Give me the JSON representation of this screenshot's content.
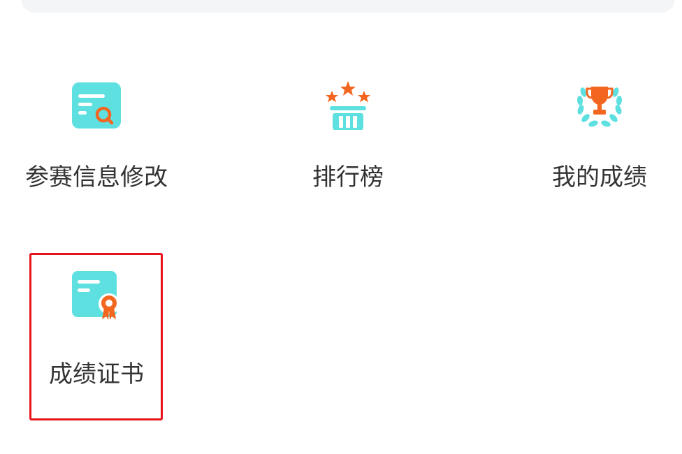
{
  "menu": {
    "items": [
      {
        "label": "参赛信息修改",
        "icon": "search-document-icon"
      },
      {
        "label": "排行榜",
        "icon": "podium-stars-icon"
      },
      {
        "label": "我的成绩",
        "icon": "trophy-laurel-icon"
      },
      {
        "label": "成绩证书",
        "icon": "certificate-icon"
      }
    ]
  },
  "colors": {
    "teal": "#5ee0e0",
    "orange": "#f2661f",
    "highlight_border": "#e8141c",
    "label_text": "#333333"
  }
}
